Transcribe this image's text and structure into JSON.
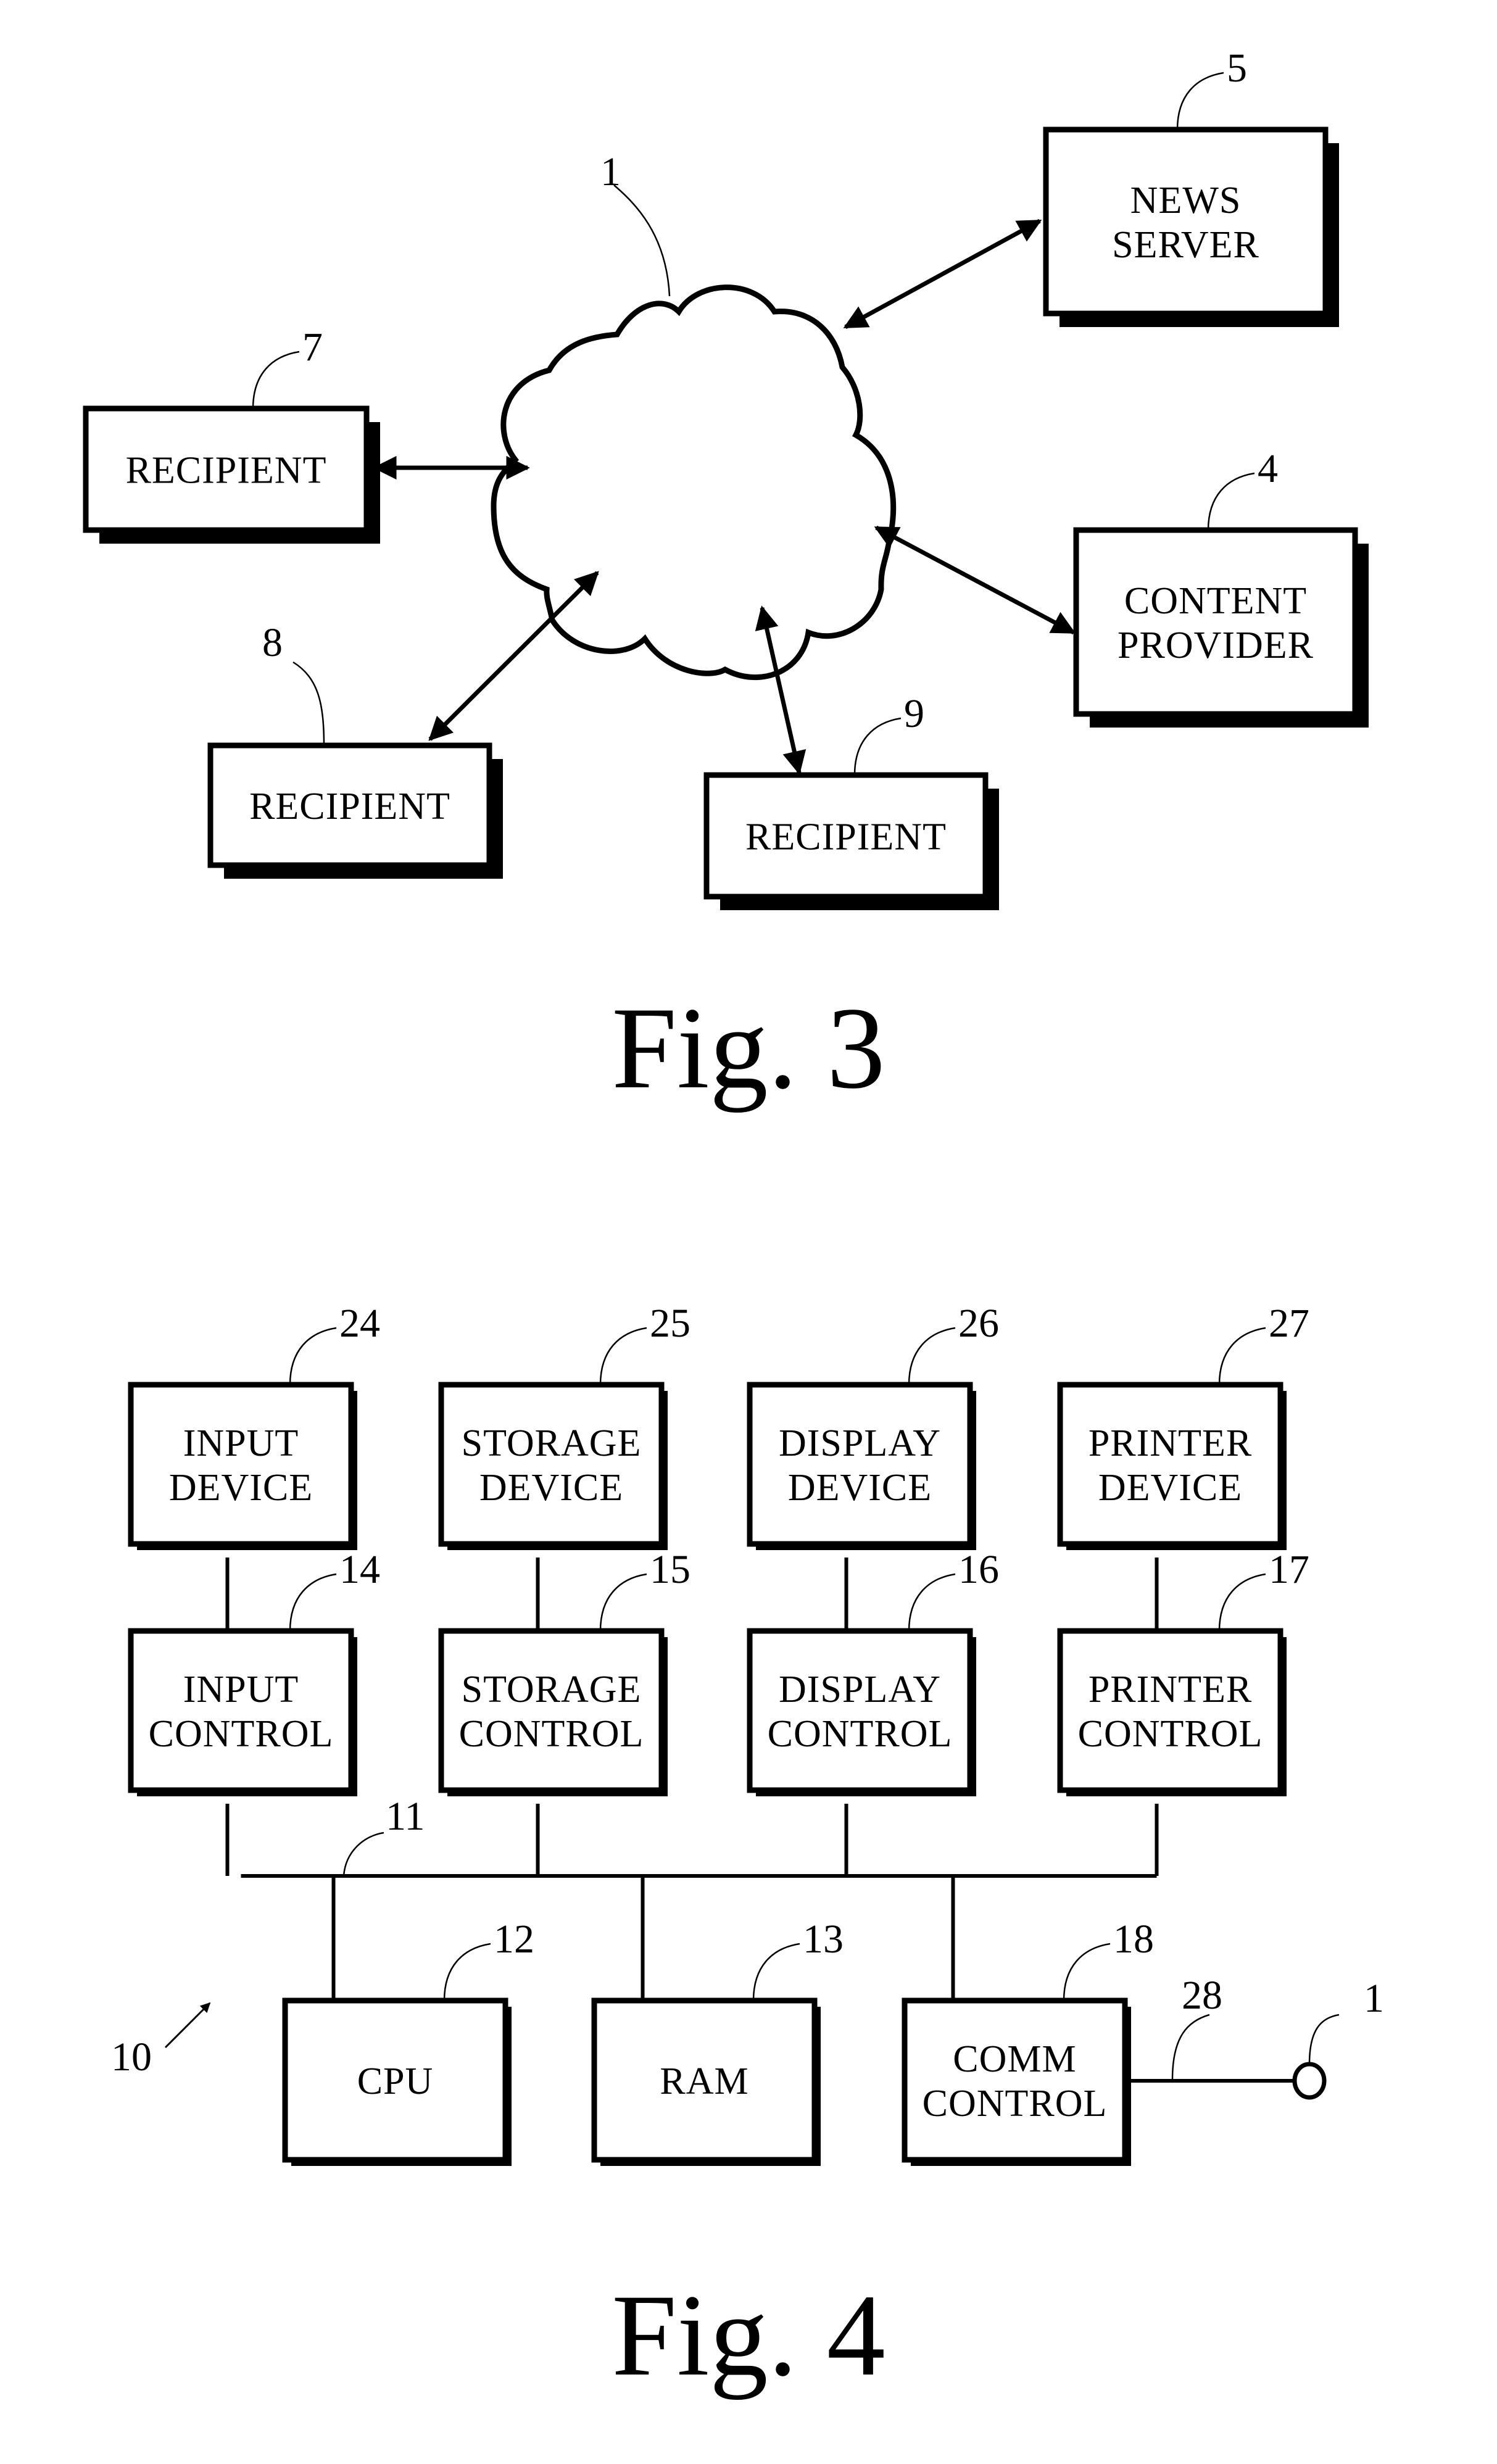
{
  "figure3": {
    "caption": "Fig. 3",
    "network": {
      "ref": "1"
    },
    "nodes": [
      {
        "id": "news-server",
        "ref": "5",
        "lines": [
          "NEWS",
          "SERVER"
        ]
      },
      {
        "id": "content-provider",
        "ref": "4",
        "lines": [
          "CONTENT",
          "PROVIDER"
        ]
      },
      {
        "id": "recipient-7",
        "ref": "7",
        "lines": [
          "RECIPIENT"
        ]
      },
      {
        "id": "recipient-8",
        "ref": "8",
        "lines": [
          "RECIPIENT"
        ]
      },
      {
        "id": "recipient-9",
        "ref": "9",
        "lines": [
          "RECIPIENT"
        ]
      }
    ],
    "connections": [
      "news-server",
      "content-provider",
      "recipient-7",
      "recipient-8",
      "recipient-9"
    ],
    "connection_type": "bidirectional"
  },
  "figure4": {
    "caption": "Fig. 4",
    "system_ref": "10",
    "bus_ref": "11",
    "network_line_ref": "28",
    "network_terminal_ref": "1",
    "devices": [
      {
        "ref": "24",
        "lines": [
          "INPUT",
          "DEVICE"
        ]
      },
      {
        "ref": "25",
        "lines": [
          "STORAGE",
          "DEVICE"
        ]
      },
      {
        "ref": "26",
        "lines": [
          "DISPLAY",
          "DEVICE"
        ]
      },
      {
        "ref": "27",
        "lines": [
          "PRINTER",
          "DEVICE"
        ]
      }
    ],
    "controls": [
      {
        "ref": "14",
        "lines": [
          "INPUT",
          "CONTROL"
        ]
      },
      {
        "ref": "15",
        "lines": [
          "STORAGE",
          "CONTROL"
        ]
      },
      {
        "ref": "16",
        "lines": [
          "DISPLAY",
          "CONTROL"
        ]
      },
      {
        "ref": "17",
        "lines": [
          "PRINTER",
          "CONTROL"
        ]
      }
    ],
    "core": [
      {
        "ref": "12",
        "lines": [
          "CPU"
        ]
      },
      {
        "ref": "13",
        "lines": [
          "RAM"
        ]
      },
      {
        "ref": "18",
        "lines": [
          "COMM",
          "CONTROL"
        ]
      }
    ]
  }
}
